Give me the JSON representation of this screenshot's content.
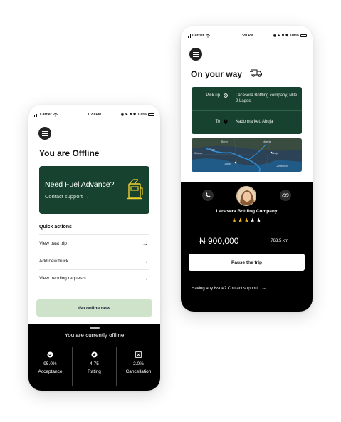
{
  "left": {
    "status": {
      "carrier": "Carrier",
      "time": "1:20 PM",
      "battery": "100%"
    },
    "title": "You are Offline",
    "fuel_card": {
      "title": "Need Fuel Advance?",
      "link": "Contact support"
    },
    "quick_actions": {
      "title": "Quick actions",
      "items": [
        {
          "label": "View past trip"
        },
        {
          "label": "Add new truck"
        },
        {
          "label": "View pending requests"
        }
      ]
    },
    "go_online_label": "Go online now",
    "sheet": {
      "offline_text": "You are  currently offline",
      "stats": [
        {
          "value": "95.0%",
          "label": "Acceptance",
          "icon": "check-badge-icon"
        },
        {
          "value": "4.75",
          "label": "Rating",
          "icon": "star-badge-icon"
        },
        {
          "value": "2.0%",
          "label": "Cancellation",
          "icon": "cancel-box-icon"
        }
      ]
    }
  },
  "right": {
    "status": {
      "carrier": "Carrier",
      "time": "1:20 PM",
      "battery": "100%"
    },
    "title": "On your way",
    "route": {
      "pickup_label": "Pick up",
      "pickup_value": "Lacasera Bottling company, Mile 2 Lagos",
      "to_label": "To",
      "to_value": "Kado market, Abuja"
    },
    "map": {
      "labels": [
        "Benin",
        "Nigeria",
        "Togo",
        "Ghana",
        "Lagos",
        "Abuja",
        "Cameroon"
      ]
    },
    "company": "Lacasera Bottling Company",
    "rating": {
      "value": 3,
      "max": 5
    },
    "price": "₦ 900,000",
    "distance": "763.5 km",
    "pause_label": "Pause the trip",
    "issue_text": "Having any issue? Contact support"
  },
  "colors": {
    "brand_green": "#17422f",
    "light_green": "#cfe3cb",
    "star": "#f4c20d"
  }
}
